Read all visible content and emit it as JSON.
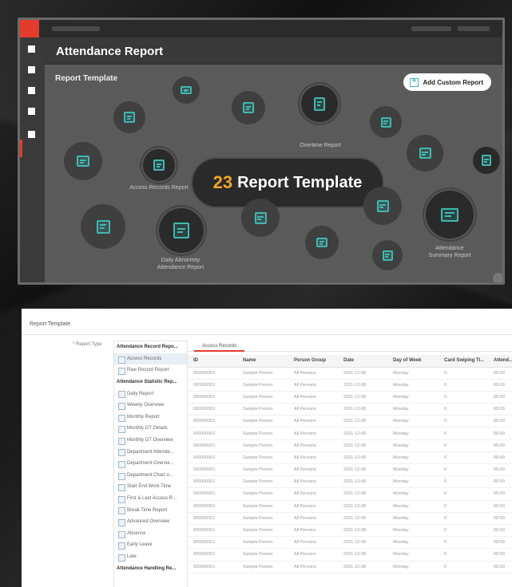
{
  "window": {
    "title": "Attendance Report",
    "section_label": "Report Template",
    "add_button_label": "Add Custom Report",
    "center": {
      "count": "23",
      "label": "Report Template"
    },
    "captions": {
      "overtime": "Overtime Report",
      "access_records": "Access Records Report",
      "daily_abnormal": "Daily Abnormity\nAttendance Report",
      "attendance_summary": "Attendance\nSummary Report"
    },
    "accent_color": "#3fb9b0",
    "brand_color": "#e53b2c"
  },
  "pane": {
    "header": "Report Template",
    "report_type_label": "* Report Type",
    "tab_label": "Access Records",
    "tree": [
      {
        "label": "Attendance Record Repo...",
        "group": true
      },
      {
        "label": "Access Records",
        "selected": true
      },
      {
        "label": "Raw Record Report"
      },
      {
        "label": "Attendance Statistic Rep...",
        "group": true
      },
      {
        "label": "Daily Report"
      },
      {
        "label": "Weekly Overview"
      },
      {
        "label": "Monthly Report"
      },
      {
        "label": "Monthly OT Details"
      },
      {
        "label": "Monthly OT Overview"
      },
      {
        "label": "Department Attenda..."
      },
      {
        "label": "Department Overvie..."
      },
      {
        "label": "Department Chart o..."
      },
      {
        "label": "Start End Work Time"
      },
      {
        "label": "First & Last Access R..."
      },
      {
        "label": "Break Time Report"
      },
      {
        "label": "Advanced Overview"
      },
      {
        "label": "Absence"
      },
      {
        "label": "Early Leave"
      },
      {
        "label": "Late"
      },
      {
        "label": "Attendance Handling Re...",
        "group": true
      }
    ],
    "columns": [
      "ID",
      "Name",
      "Person Group",
      "Date",
      "Day of Week",
      "Card Swiping Ti...",
      "Attend..."
    ],
    "rows": [
      [
        "000000001",
        "Sample Person",
        "All Persons",
        "2021-12-08",
        "Monday",
        "0",
        "09:00"
      ],
      [
        "000000001",
        "Sample Person",
        "All Persons",
        "2021-12-08",
        "Monday",
        "0",
        "09:00"
      ],
      [
        "000000001",
        "Sample Person",
        "All Persons",
        "2021-12-08",
        "Monday",
        "0",
        "09:00"
      ],
      [
        "000000001",
        "Sample Person",
        "All Persons",
        "2021-12-08",
        "Monday",
        "0",
        "09:00"
      ],
      [
        "000000001",
        "Sample Person",
        "All Persons",
        "2021-12-08",
        "Monday",
        "0",
        "09:00"
      ],
      [
        "000000001",
        "Sample Person",
        "All Persons",
        "2021-12-08",
        "Monday",
        "0",
        "09:00"
      ],
      [
        "000000001",
        "Sample Person",
        "All Persons",
        "2021-12-08",
        "Monday",
        "0",
        "09:00"
      ],
      [
        "000000001",
        "Sample Person",
        "All Persons",
        "2021-12-08",
        "Monday",
        "0",
        "09:00"
      ],
      [
        "000000001",
        "Sample Person",
        "All Persons",
        "2021-12-08",
        "Monday",
        "0",
        "09:00"
      ],
      [
        "000000001",
        "Sample Person",
        "All Persons",
        "2021-12-08",
        "Monday",
        "0",
        "09:00"
      ],
      [
        "000000001",
        "Sample Person",
        "All Persons",
        "2021-12-08",
        "Monday",
        "0",
        "09:00"
      ],
      [
        "000000001",
        "Sample Person",
        "All Persons",
        "2021-12-08",
        "Monday",
        "0",
        "09:00"
      ],
      [
        "000000001",
        "Sample Person",
        "All Persons",
        "2021-12-08",
        "Monday",
        "0",
        "09:00"
      ],
      [
        "000000001",
        "Sample Person",
        "All Persons",
        "2021-12-08",
        "Monday",
        "0",
        "09:00"
      ],
      [
        "000000001",
        "Sample Person",
        "All Persons",
        "2021-12-08",
        "Monday",
        "0",
        "09:00"
      ],
      [
        "000000001",
        "Sample Person",
        "All Persons",
        "2021-12-08",
        "Monday",
        "0",
        "09:00"
      ],
      [
        "000000001",
        "Sample Person",
        "All Persons",
        "2021-12-08",
        "Monday",
        "0",
        "09:00"
      ]
    ]
  }
}
